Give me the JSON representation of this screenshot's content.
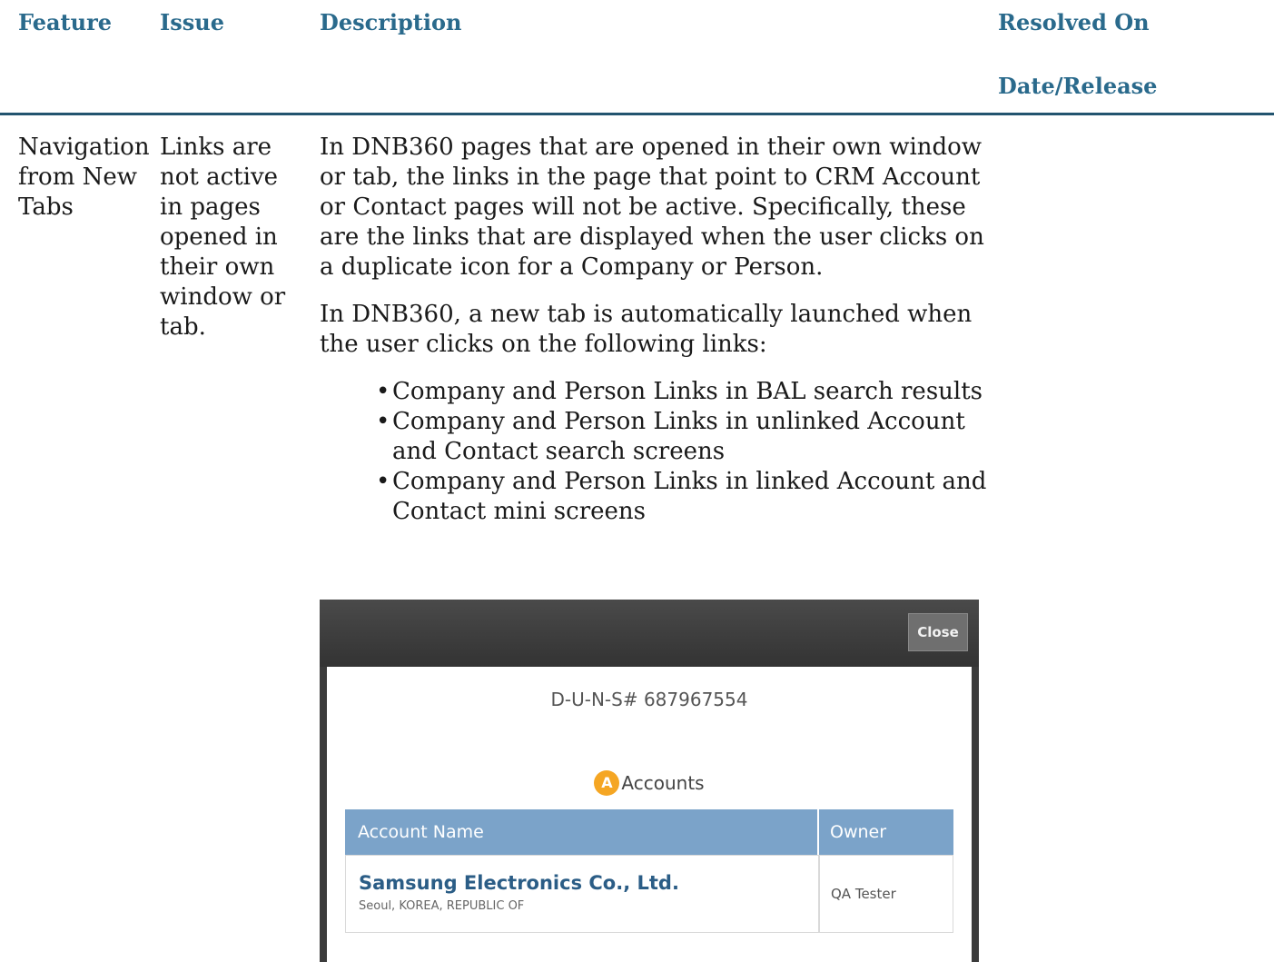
{
  "table_header": {
    "feature": "Feature",
    "issue": "Issue",
    "description": "Description",
    "resolved_line1": "Resolved On",
    "resolved_line2": "Date/Release"
  },
  "row": {
    "feature": "Navigation from New Tabs",
    "issue": "Links are not active in pages opened in their own window or tab.",
    "description_p1": "In DNB360 pages that are opened in their own window or tab, the links in the page that point to CRM Account or Contact pages will not be active. Specifically, these are the links that are displayed when the user clicks on a duplicate icon for a Company or Person.",
    "description_p2": "In DNB360, a new tab is automatically launched when the user clicks on the following links:",
    "bullets": [
      "Company and Person Links in BAL search results",
      "Company and Person Links in unlinked Account and Contact search screens",
      "Company and Person Links in linked Account and Contact mini screens"
    ],
    "resolved": ""
  },
  "screenshot": {
    "close_label": "Close",
    "duns": "D-U-N-S# 687967554",
    "accounts_icon_letter": "A",
    "accounts_label": "Accounts",
    "col_account_name": "Account Name",
    "col_owner": "Owner",
    "account_name": "Samsung Electronics Co., Ltd.",
    "account_location": "Seoul, KOREA, REPUBLIC OF",
    "owner": "QA Tester",
    "icon_color": "#f5a623",
    "header_color": "#7ba3c9"
  }
}
